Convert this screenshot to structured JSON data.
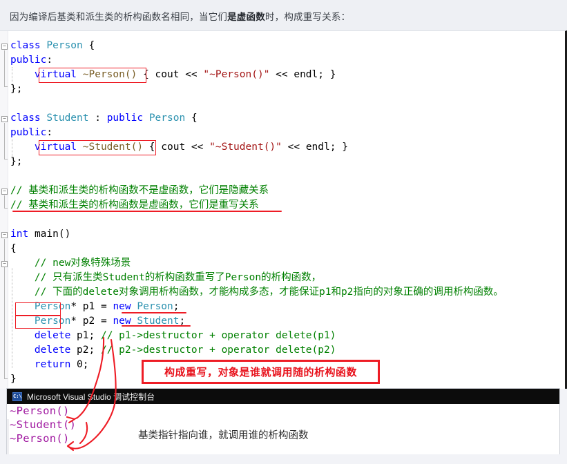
{
  "intro": {
    "text_before": "因为编译后基类和派生类的析构函数名相同，当它们",
    "text_bold": "是虚函数",
    "text_after": "时，构成重写关系："
  },
  "editor": {
    "lines": [
      {
        "tokens": [
          {
            "t": "class",
            "c": "kw"
          },
          {
            "t": " ",
            "c": "pun"
          },
          {
            "t": "Person",
            "c": "typ"
          },
          {
            "t": " {",
            "c": "pun"
          }
        ]
      },
      {
        "tokens": [
          {
            "t": "public",
            "c": "kw"
          },
          {
            "t": ":",
            "c": "pun"
          }
        ]
      },
      {
        "tokens": [
          {
            "t": "    ",
            "c": "pun"
          },
          {
            "t": "virtual",
            "c": "kw"
          },
          {
            "t": " ",
            "c": "pun"
          },
          {
            "t": "~Person()",
            "c": "fn"
          },
          {
            "t": " { ",
            "c": "pun"
          },
          {
            "t": "cout",
            "c": "pun"
          },
          {
            "t": " << ",
            "c": "op"
          },
          {
            "t": "\"~Person()\"",
            "c": "str"
          },
          {
            "t": " << ",
            "c": "op"
          },
          {
            "t": "endl",
            "c": "pun"
          },
          {
            "t": "; }",
            "c": "pun"
          }
        ]
      },
      {
        "tokens": [
          {
            "t": "};",
            "c": "pun"
          }
        ]
      },
      {
        "tokens": []
      },
      {
        "tokens": [
          {
            "t": "class",
            "c": "kw"
          },
          {
            "t": " ",
            "c": "pun"
          },
          {
            "t": "Student",
            "c": "typ"
          },
          {
            "t": " : ",
            "c": "pun"
          },
          {
            "t": "public",
            "c": "kw"
          },
          {
            "t": " ",
            "c": "pun"
          },
          {
            "t": "Person",
            "c": "typ"
          },
          {
            "t": " {",
            "c": "pun"
          }
        ]
      },
      {
        "tokens": [
          {
            "t": "public",
            "c": "kw"
          },
          {
            "t": ":",
            "c": "pun"
          }
        ]
      },
      {
        "tokens": [
          {
            "t": "    ",
            "c": "pun"
          },
          {
            "t": "virtual",
            "c": "kw"
          },
          {
            "t": " ",
            "c": "pun"
          },
          {
            "t": "~Student()",
            "c": "fn"
          },
          {
            "t": " { ",
            "c": "pun"
          },
          {
            "t": "cout",
            "c": "pun"
          },
          {
            "t": " << ",
            "c": "op"
          },
          {
            "t": "\"~Student()\"",
            "c": "str"
          },
          {
            "t": " << ",
            "c": "op"
          },
          {
            "t": "endl",
            "c": "pun"
          },
          {
            "t": "; }",
            "c": "pun"
          }
        ]
      },
      {
        "tokens": [
          {
            "t": "};",
            "c": "pun"
          }
        ]
      },
      {
        "tokens": []
      },
      {
        "tokens": [
          {
            "t": "// 基类和派生类的析构函数不是虚函数，它们是隐藏关系",
            "c": "cmt"
          }
        ]
      },
      {
        "tokens": [
          {
            "t": "// 基类和派生类的析构函数是虚函数，它们是重写关系",
            "c": "cmt"
          }
        ]
      },
      {
        "tokens": []
      },
      {
        "tokens": [
          {
            "t": "int",
            "c": "kw"
          },
          {
            "t": " ",
            "c": "pun"
          },
          {
            "t": "main",
            "c": "pun"
          },
          {
            "t": "()",
            "c": "pun"
          }
        ]
      },
      {
        "tokens": [
          {
            "t": "{",
            "c": "pun"
          }
        ]
      },
      {
        "tokens": [
          {
            "t": "    // new对象特殊场景",
            "c": "cmt"
          }
        ]
      },
      {
        "tokens": [
          {
            "t": "    // 只有派生类Student的析构函数重写了Person的析构函数，",
            "c": "cmt"
          }
        ]
      },
      {
        "tokens": [
          {
            "t": "    // 下面的delete对象调用析构函数，才能构成多态，才能保证p1和p2指向的对象正确的调用析构函数。",
            "c": "cmt"
          }
        ]
      },
      {
        "tokens": [
          {
            "t": "    ",
            "c": "pun"
          },
          {
            "t": "Person",
            "c": "typ"
          },
          {
            "t": "*",
            "c": "pun"
          },
          {
            "t": " p1 = ",
            "c": "pun"
          },
          {
            "t": "new",
            "c": "kw"
          },
          {
            "t": " ",
            "c": "pun"
          },
          {
            "t": "Person",
            "c": "typ"
          },
          {
            "t": ";",
            "c": "pun"
          }
        ]
      },
      {
        "tokens": [
          {
            "t": "    ",
            "c": "pun"
          },
          {
            "t": "Person",
            "c": "typ"
          },
          {
            "t": "*",
            "c": "pun"
          },
          {
            "t": " p2 = ",
            "c": "pun"
          },
          {
            "t": "new",
            "c": "kw"
          },
          {
            "t": " ",
            "c": "pun"
          },
          {
            "t": "Student",
            "c": "typ"
          },
          {
            "t": ";",
            "c": "pun"
          }
        ]
      },
      {
        "tokens": [
          {
            "t": "    ",
            "c": "pun"
          },
          {
            "t": "delete",
            "c": "kw"
          },
          {
            "t": " p1; ",
            "c": "pun"
          },
          {
            "t": "// p1->destructor + operator delete(p1)",
            "c": "cmt"
          }
        ]
      },
      {
        "tokens": [
          {
            "t": "    ",
            "c": "pun"
          },
          {
            "t": "delete",
            "c": "kw"
          },
          {
            "t": " p2; ",
            "c": "pun"
          },
          {
            "t": "// p2->destructor + operator delete(p2)",
            "c": "cmt"
          }
        ]
      },
      {
        "tokens": [
          {
            "t": "    ",
            "c": "pun"
          },
          {
            "t": "return",
            "c": "kw"
          },
          {
            "t": " 0;",
            "c": "pun"
          }
        ]
      },
      {
        "tokens": [
          {
            "t": "}",
            "c": "pun"
          }
        ]
      }
    ]
  },
  "annotations": {
    "callout_text": "构成重写，对象是谁就调用随的析构函数",
    "console_note": "基类指针指向谁，就调用谁的析构函数",
    "accent_color": "#ee1c25"
  },
  "console": {
    "title": "Microsoft Visual Studio 调试控制台",
    "icon_label": "C:\\",
    "lines": [
      "~Person()",
      "~Student()",
      "~Person()"
    ]
  }
}
